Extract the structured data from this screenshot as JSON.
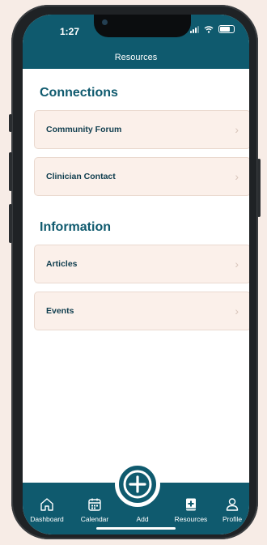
{
  "status_bar": {
    "time": "1:27"
  },
  "header": {
    "title": "Resources"
  },
  "sections": [
    {
      "title": "Connections",
      "items": [
        {
          "label": "Community Forum"
        },
        {
          "label": "Clinician Contact"
        }
      ]
    },
    {
      "title": "Information",
      "items": [
        {
          "label": "Articles"
        },
        {
          "label": "Events"
        }
      ]
    }
  ],
  "tabbar": {
    "tabs": [
      {
        "label": "Dashboard",
        "icon": "home-icon"
      },
      {
        "label": "Calendar",
        "icon": "calendar-icon"
      },
      {
        "label": "Add",
        "icon": "plus-circle-icon"
      },
      {
        "label": "Resources",
        "icon": "book-plus-icon"
      },
      {
        "label": "Profile",
        "icon": "person-icon"
      }
    ],
    "active": "Resources"
  },
  "colors": {
    "primary": "#0f5a6e",
    "card_bg": "#fbf0ea",
    "page_bg": "#f7ece6"
  }
}
